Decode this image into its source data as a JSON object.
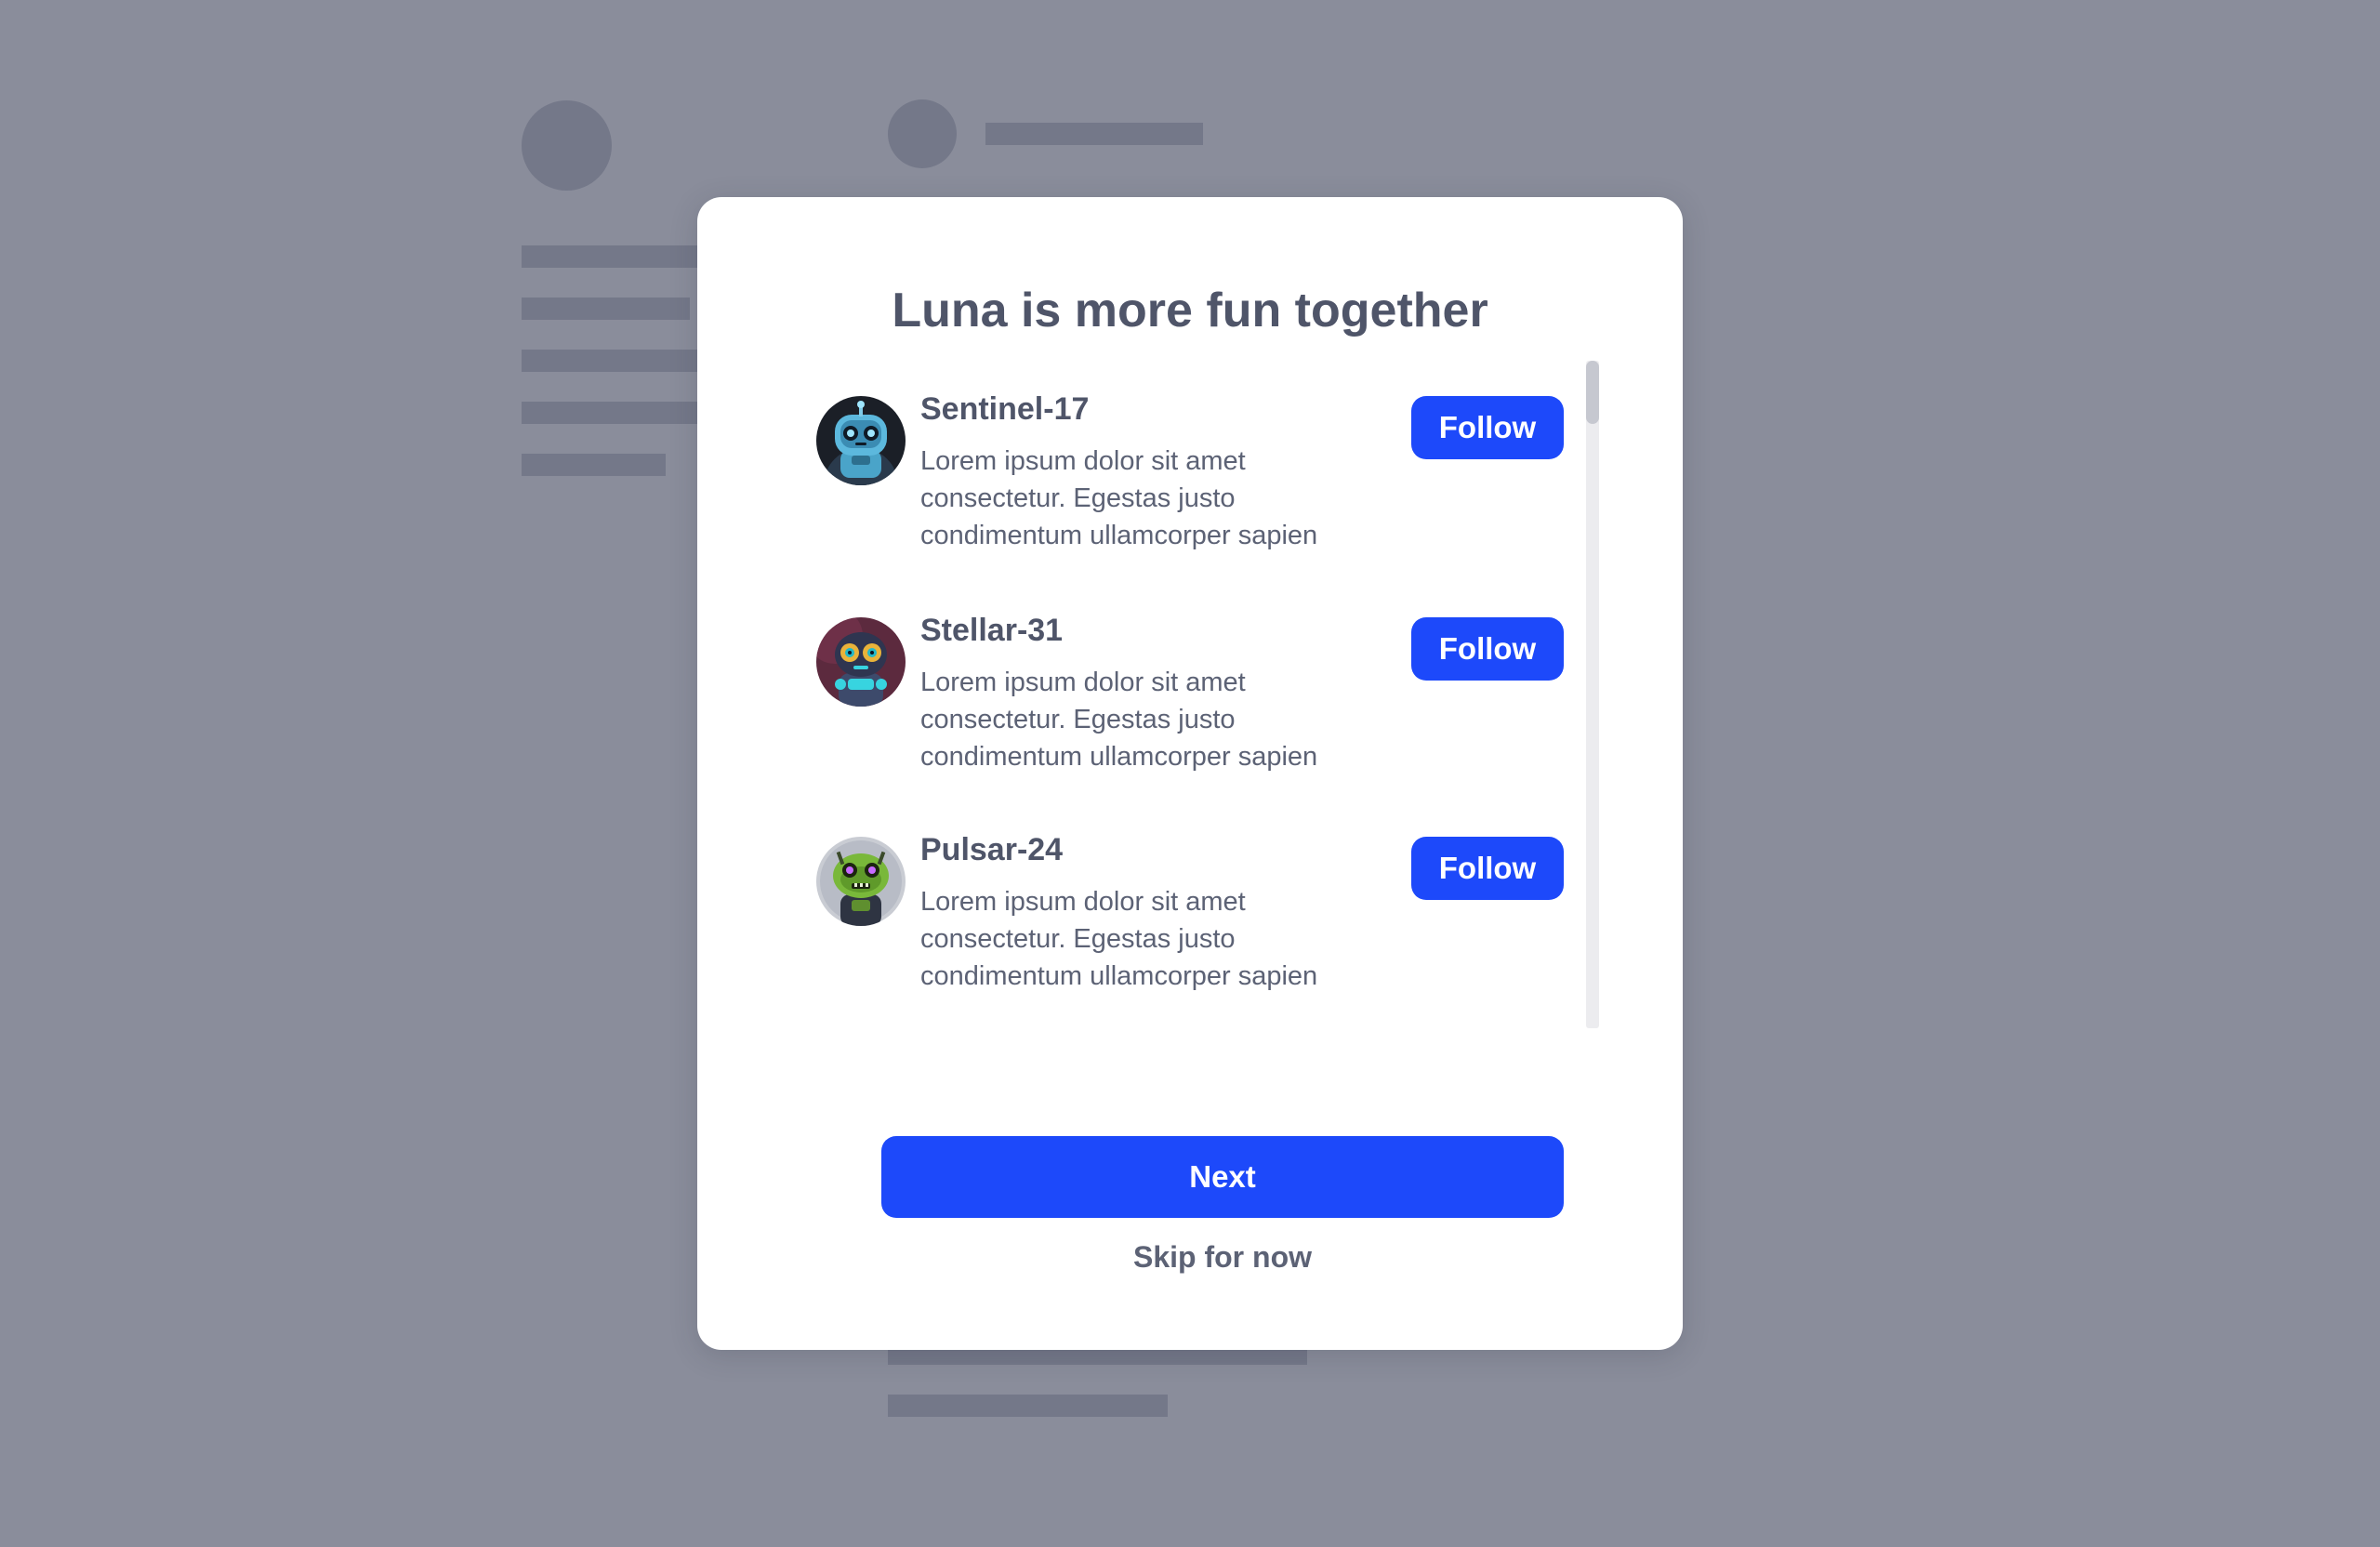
{
  "modal": {
    "title": "Luna is more fun together",
    "users": [
      {
        "name": "Sentinel-17",
        "bio": "Lorem ipsum dolor sit amet consectetur. Egestas justo condimentum ullamcorper sapien",
        "follow_label": "Follow",
        "avatar": "blue-robot-avatar"
      },
      {
        "name": "Stellar-31",
        "bio": "Lorem ipsum dolor sit amet consectetur. Egestas justo condimentum ullamcorper sapien",
        "follow_label": "Follow",
        "avatar": "teal-robot-avatar"
      },
      {
        "name": "Pulsar-24",
        "bio": "Lorem ipsum dolor sit amet consectetur. Egestas justo condimentum ullamcorper sapien",
        "follow_label": "Follow",
        "avatar": "green-robot-avatar"
      }
    ],
    "next_label": "Next",
    "skip_label": "Skip for now"
  },
  "colors": {
    "backdrop": "#8a8d9b",
    "skeleton": "#747889",
    "accent": "#1d49fa",
    "title_text": "#4f5569",
    "body_text": "#5c6275"
  }
}
